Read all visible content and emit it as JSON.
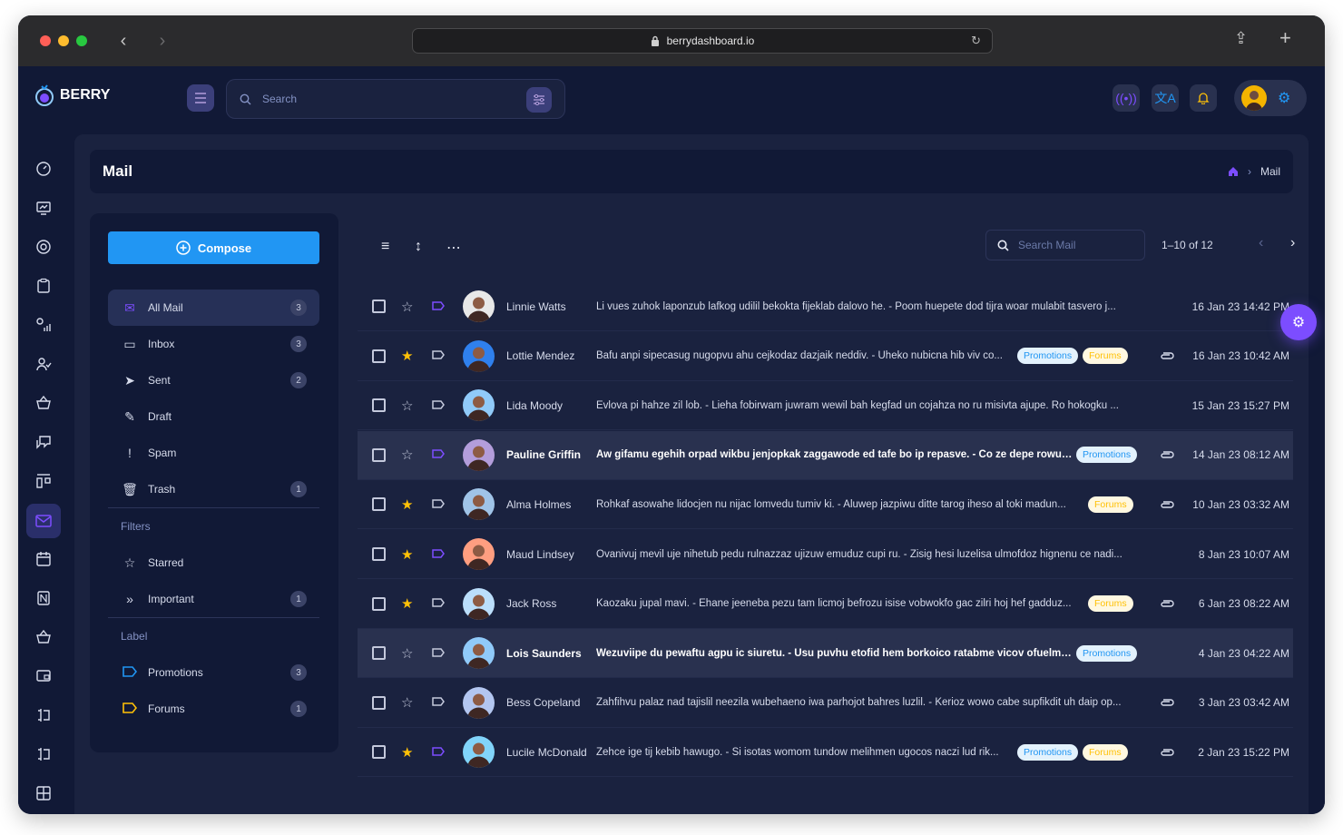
{
  "browser": {
    "url": "berrydashboard.io"
  },
  "app": {
    "logo_text": "BERRY",
    "search_placeholder": "Search"
  },
  "page": {
    "title": "Mail",
    "breadcrumb_current": "Mail"
  },
  "compose_label": "Compose",
  "folders": [
    {
      "label": "All Mail",
      "count": "3",
      "icon": "mail-icon"
    },
    {
      "label": "Inbox",
      "count": "3",
      "icon": "inbox-icon"
    },
    {
      "label": "Sent",
      "count": "2",
      "icon": "send-icon"
    },
    {
      "label": "Draft",
      "count": "",
      "icon": "draft-icon"
    },
    {
      "label": "Spam",
      "count": "",
      "icon": "spam-icon"
    },
    {
      "label": "Trash",
      "count": "1",
      "icon": "trash-icon"
    }
  ],
  "filters_heading": "Filters",
  "filters": [
    {
      "label": "Starred",
      "count": "",
      "icon": "star-icon"
    },
    {
      "label": "Important",
      "count": "1",
      "icon": "important-icon"
    }
  ],
  "label_heading": "Label",
  "labels": [
    {
      "label": "Promotions",
      "count": "3",
      "color": "#2196f3"
    },
    {
      "label": "Forums",
      "count": "1",
      "color": "#ffc107"
    }
  ],
  "list": {
    "search_placeholder": "Search Mail",
    "pager": "1–10 of 12"
  },
  "chips": {
    "promotions": "Promotions",
    "forums": "Forums"
  },
  "mails": [
    {
      "sender": "Linnie Watts",
      "subject": "Li vues zuhok laponzub lafkog udilil bekokta fijeklab dalovo he. - Poom huepete dod tijra woar mulabit tasvero j...",
      "date": "16 Jan 23 14:42 PM",
      "starred": false,
      "important": true,
      "unread": false,
      "promotions": false,
      "forums": false,
      "attachment": false,
      "avatar_color": "#e8e8e8"
    },
    {
      "sender": "Lottie Mendez",
      "subject": "Bafu anpi sipecasug nugopvu ahu cejkodaz dazjaik neddiv. - Uheko nubicna hib viv co...",
      "date": "16 Jan 23 10:42 AM",
      "starred": true,
      "important": false,
      "unread": false,
      "promotions": true,
      "forums": true,
      "attachment": true,
      "avatar_color": "#2f80ed"
    },
    {
      "sender": "Lida Moody",
      "subject": "Evlova pi hahze zil lob. - Lieha fobirwam juwram wewil bah kegfad un cojahza no ru misivta ajupe. Ro hokogku ...",
      "date": "15 Jan 23 15:27 PM",
      "starred": false,
      "important": false,
      "unread": false,
      "promotions": false,
      "forums": false,
      "attachment": false,
      "avatar_color": "#90caf9"
    },
    {
      "sender": "Pauline Griffin",
      "subject": "Aw gifamu egehih orpad wikbu jenjopkak zaggawode ed tafe bo ip repasve. - Co ze depe rowufu...",
      "date": "14 Jan 23 08:12 AM",
      "starred": false,
      "important": true,
      "unread": true,
      "promotions": true,
      "forums": false,
      "attachment": true,
      "avatar_color": "#b39ddb"
    },
    {
      "sender": "Alma Holmes",
      "subject": "Rohkaf asowahe lidocjen nu nijac lomvedu tumiv ki. - Aluwep jazpiwu ditte tarog iheso al toki madun...",
      "date": "10 Jan 23 03:32 AM",
      "starred": true,
      "important": false,
      "unread": false,
      "promotions": false,
      "forums": true,
      "attachment": true,
      "avatar_color": "#a0c4e8"
    },
    {
      "sender": "Maud Lindsey",
      "subject": "Ovanivuj mevil uje nihetub pedu rulnazzaz ujizuw emuduz cupi ru. - Zisig hesi luzelisa ulmofdoz hignenu ce nadi...",
      "date": "8 Jan 23 10:07 AM",
      "starred": true,
      "important": true,
      "unread": false,
      "promotions": false,
      "forums": false,
      "attachment": false,
      "avatar_color": "#ff9e80"
    },
    {
      "sender": "Jack Ross",
      "subject": "Kaozaku jupal mavi. - Ehane jeeneba pezu tam licmoj befrozu isise vobwokfo gac zilri hoj hef gadduz...",
      "date": "6 Jan 23 08:22 AM",
      "starred": true,
      "important": false,
      "unread": false,
      "promotions": false,
      "forums": true,
      "attachment": true,
      "avatar_color": "#bbdefb"
    },
    {
      "sender": "Lois Saunders",
      "subject": "Wezuviipe du pewaftu agpu ic siuretu. - Usu puvhu etofid hem borkoico ratabme vicov ofuelmu v...",
      "date": "4 Jan 23 04:22 AM",
      "starred": false,
      "important": false,
      "unread": true,
      "promotions": true,
      "forums": false,
      "attachment": false,
      "avatar_color": "#90caf9"
    },
    {
      "sender": "Bess Copeland",
      "subject": "Zahfihvu palaz nad tajislil neezila wubehaeno iwa parhojot bahres luzlil. - Kerioz wowo cabe supfikdit uh daip op...",
      "date": "3 Jan 23 03:42 AM",
      "starred": false,
      "important": false,
      "unread": false,
      "promotions": false,
      "forums": false,
      "attachment": true,
      "avatar_color": "#b3c6f0"
    },
    {
      "sender": "Lucile McDonald",
      "subject": "Zehce ige tij kebib hawugo. - Si isotas womom tundow melihmen ugocos naczi lud rik...",
      "date": "2 Jan 23 15:22 PM",
      "starred": true,
      "important": true,
      "unread": false,
      "promotions": true,
      "forums": true,
      "attachment": true,
      "avatar_color": "#81d4fa"
    }
  ]
}
